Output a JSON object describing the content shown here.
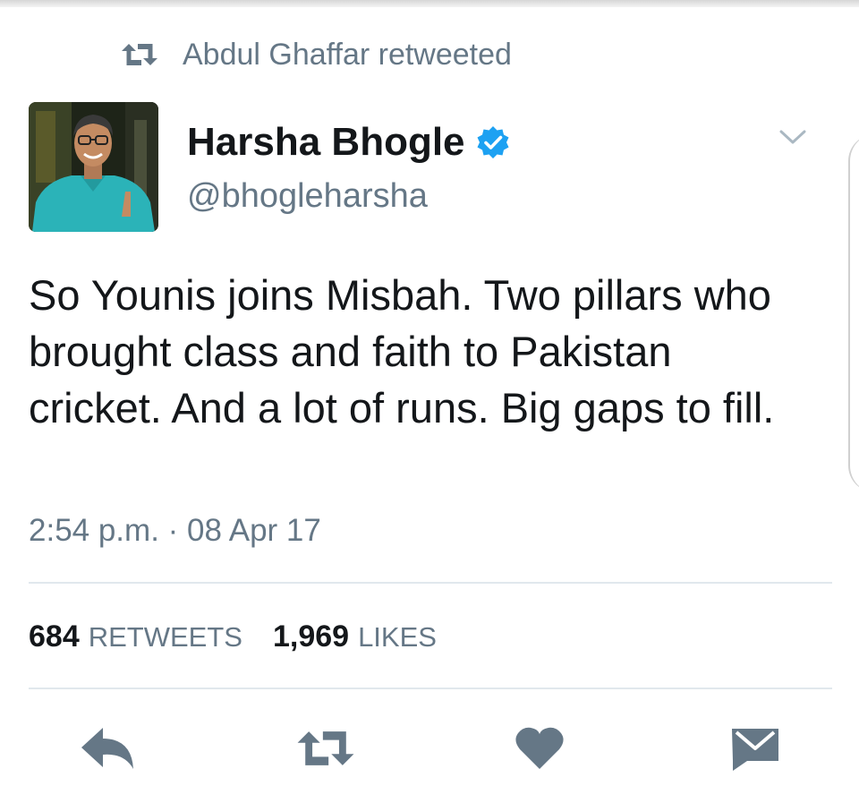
{
  "context": {
    "icon": "retweet-icon",
    "text": "Abdul Ghaffar retweeted"
  },
  "author": {
    "name": "Harsha Bhogle",
    "handle": "@bhogleharsha",
    "verified": true,
    "verified_color": "#1da1f2"
  },
  "tweet": {
    "text": "So Younis joins Misbah. Two pillars who brought class and faith to Pakistan cricket. And a lot of runs. Big gaps to fill.",
    "timestamp": "2:54 p.m. · 08 Apr 17"
  },
  "stats": {
    "retweets_count": "684",
    "retweets_label": "RETWEETS",
    "likes_count": "1,969",
    "likes_label": "LIKES"
  },
  "actions": [
    {
      "icon": "reply-icon"
    },
    {
      "icon": "retweet-icon"
    },
    {
      "icon": "heart-icon"
    },
    {
      "icon": "message-icon"
    }
  ],
  "colors": {
    "secondary_text": "#657786",
    "icon_gray": "#657786",
    "divider": "#e1e8ed"
  }
}
